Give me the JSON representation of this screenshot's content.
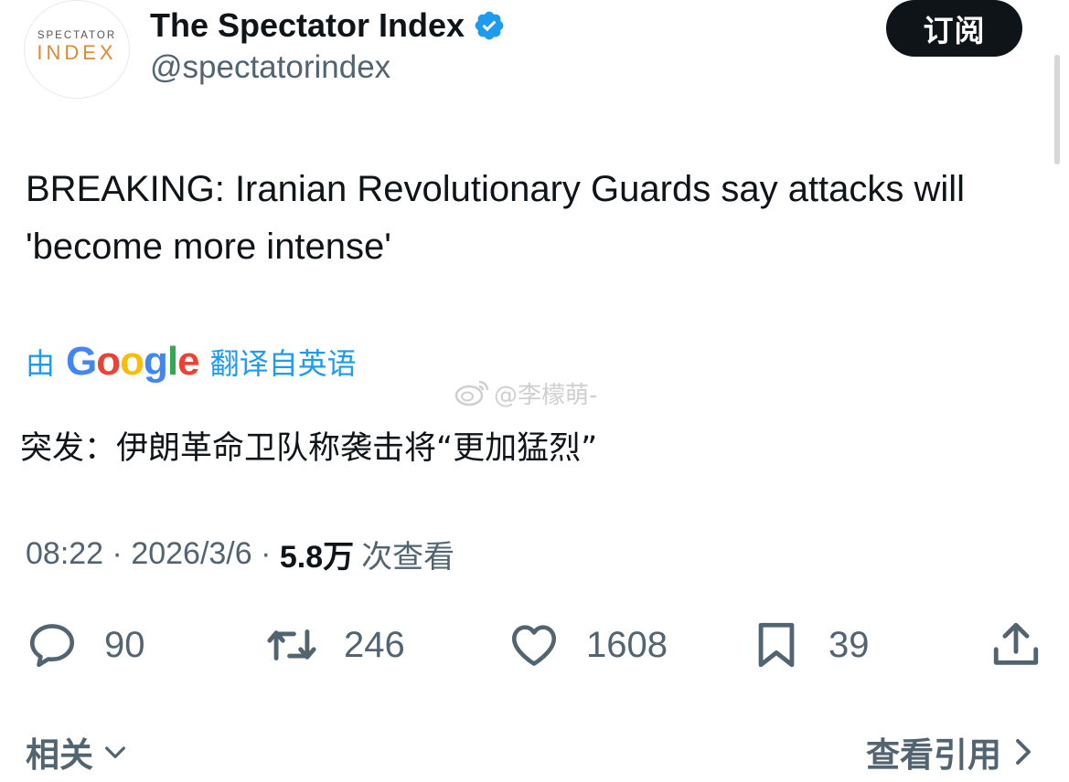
{
  "author": {
    "avatar_line1": "SPECTATOR",
    "avatar_line2": "INDEX",
    "avatar_accent": "#e08a2e",
    "display_name": "The Spectator Index",
    "verified_icon": "verified-badge-icon",
    "handle": "@spectatorindex"
  },
  "subscribe_label": "订阅",
  "tweet": {
    "text": "BREAKING: Iranian Revolutionary Guards say attacks will 'become more intense'"
  },
  "translation": {
    "prefix": "由",
    "provider_letters": [
      "G",
      "o",
      "o",
      "g",
      "l",
      "e"
    ],
    "suffix": "翻译自英语",
    "text": "突发：伊朗革命卫队称袭击将“更加猛烈”",
    "accent": "#1d9bf0"
  },
  "watermark": {
    "icon": "weibo-icon",
    "text": "@李檬萌-"
  },
  "meta": {
    "time": "08:22",
    "date": "2026/3/6",
    "views_count": "5.8万",
    "views_label": "次查看"
  },
  "actions": {
    "replies": "90",
    "retweets": "246",
    "likes": "1608",
    "bookmarks": "39"
  },
  "footer": {
    "related_label": "相关",
    "quotes_label": "查看引用"
  }
}
